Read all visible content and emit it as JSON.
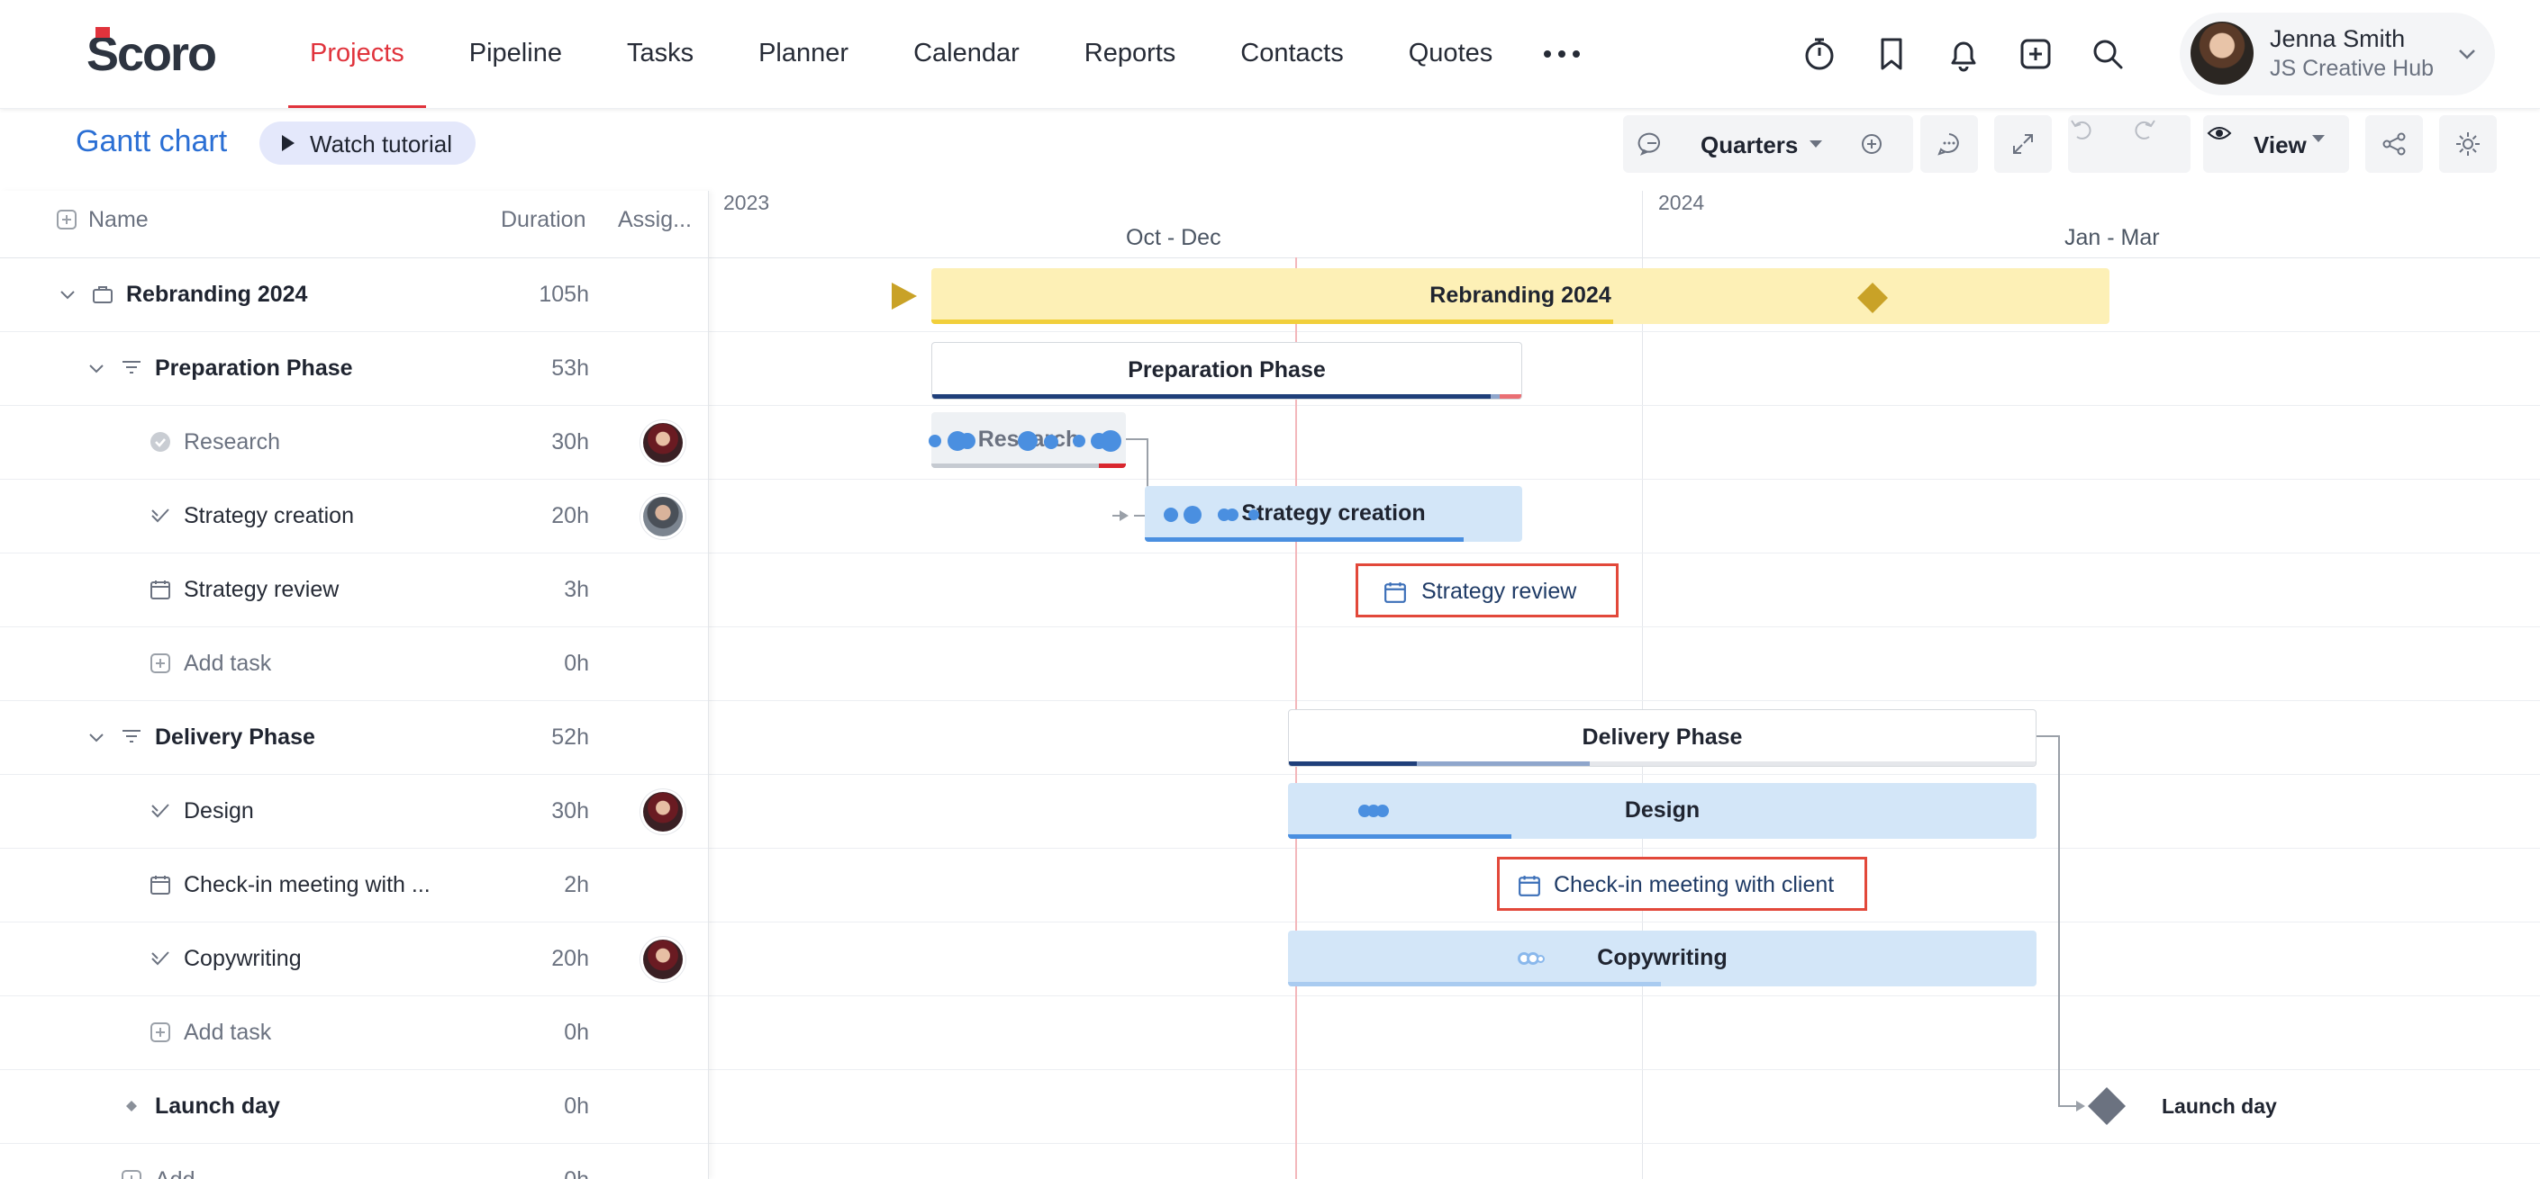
{
  "app": {
    "logo": "Scoro"
  },
  "nav": {
    "items": [
      "Projects",
      "Pipeline",
      "Tasks",
      "Planner",
      "Calendar",
      "Reports",
      "Contacts",
      "Quotes"
    ],
    "active": "Projects",
    "more_icon": "more-dots-icon"
  },
  "toolbar_icons": [
    "stopwatch-icon",
    "bookmark-icon",
    "bell-icon",
    "add-square-icon",
    "search-icon"
  ],
  "user": {
    "name": "Jenna Smith",
    "org": "JS Creative Hub"
  },
  "page": {
    "title": "Gantt chart",
    "tutorial_label": "Watch tutorial"
  },
  "gantt_toolbar": {
    "zoom_label": "Quarters",
    "view_label": "View"
  },
  "grid": {
    "columns": {
      "name": "Name",
      "duration": "Duration",
      "assignee": "Assig..."
    },
    "rows": [
      {
        "name": "Rebranding 2024",
        "duration": "105h",
        "type": "project"
      },
      {
        "name": "Preparation Phase",
        "duration": "53h",
        "type": "phase"
      },
      {
        "name": "Research",
        "duration": "30h",
        "type": "task-done"
      },
      {
        "name": "Strategy creation",
        "duration": "20h",
        "type": "task"
      },
      {
        "name": "Strategy review",
        "duration": "3h",
        "type": "event"
      },
      {
        "name": "Add task",
        "duration": "0h",
        "type": "add"
      },
      {
        "name": "Delivery Phase",
        "duration": "52h",
        "type": "phase"
      },
      {
        "name": "Design",
        "duration": "30h",
        "type": "task"
      },
      {
        "name": "Check-in meeting with ...",
        "duration": "2h",
        "type": "event"
      },
      {
        "name": "Copywriting",
        "duration": "20h",
        "type": "task"
      },
      {
        "name": "Add task",
        "duration": "0h",
        "type": "add"
      },
      {
        "name": "Launch day",
        "duration": "0h",
        "type": "milestone"
      },
      {
        "name": "Add",
        "duration": "0h",
        "type": "add"
      }
    ]
  },
  "timeline": {
    "years": [
      "2023",
      "2024"
    ],
    "quarters": [
      "Oct - Dec",
      "Jan - Mar"
    ],
    "bars": {
      "project": "Rebranding 2024",
      "prep": "Preparation Phase",
      "research": "Research",
      "strategy_creation": "Strategy creation",
      "strategy_review": "Strategy review",
      "delivery": "Delivery Phase",
      "design": "Design",
      "checkin": "Check-in meeting with client",
      "copywriting": "Copywriting",
      "launch": "Launch day"
    },
    "colors": {
      "accent": "#e0333c",
      "link": "#2b6fd4",
      "task": "#d3e6f8",
      "project": "#fdf0b6",
      "milestone": "#c9a227"
    }
  }
}
